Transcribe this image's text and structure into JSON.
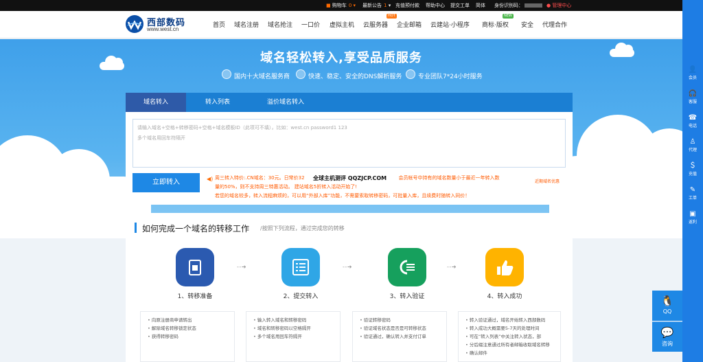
{
  "topbar": {
    "cart_label": "购物车",
    "cart_count": "0",
    "announcement": "最新公告",
    "announcement_count": "1",
    "prepay": "充值预付款",
    "help": "帮助中心",
    "ticket": "提交工单",
    "simplified": "简体",
    "id_label": "身份识别码：",
    "admin": "管理中心"
  },
  "header": {
    "logo_name": "西部数码",
    "logo_url": "www.west.cn",
    "nav": [
      "首页",
      "域名注册",
      "域名抢注",
      "一口价",
      "虚拟主机",
      "云服务器",
      "企业邮箱",
      "云建站·小程序",
      "商标·版权",
      "安全",
      "代理合作"
    ],
    "badge_hot": "HOT",
    "badge_new": "NEW"
  },
  "banner": {
    "headline": "域名轻松转入,享受品质服务",
    "features": [
      "国内十大域名服务商",
      "快速、稳定、安全的DNS解析服务",
      "专业团队7*24小时服务"
    ]
  },
  "card": {
    "tabs": [
      "域名转入",
      "转入列表",
      "溢价域名转入"
    ],
    "placeholder_line1": "请输入域名+空格+转移密码+空格+域名模板ID（此项可不填），比如：west.cn  password1  123",
    "placeholder_line2": "多个域名用回车符隔开",
    "submit": "立即转入",
    "notice_line1a": "周三转入特价:.CN域名：30元。日常价32",
    "notice_line1b": "会员帐号中持有的域名数量小于最近一年转入数",
    "notice_line2": "量的50%，则不支持周三特惠活动。  建站域名5折转入活动开始了!",
    "notice_line3": "若您的域名较多，转入流程麻烦的，可以用“外部入库”功能，不需要索取转移密码，可批量入库，且续费时随转入同价！",
    "overlay": "全球主机测评 QQZJCP.COM",
    "recent_link": "近期域名优惠"
  },
  "process": {
    "title": "如何完成一个域名的转移工作",
    "subtitle": "/按照下列流程，通过完成您的转移",
    "steps": [
      {
        "label": "1、转移准备",
        "items": [
          "向原注册商申请转出",
          "解除域名转移锁定状态",
          "获得转移密码"
        ]
      },
      {
        "label": "2、提交转入",
        "items": [
          "输入转入域名和转移密码",
          "域名和转移密码以空格隔开",
          "多个域名用回车符隔开"
        ]
      },
      {
        "label": "3、转入验证",
        "items": [
          "验证转移密码",
          "验证域名状态是否是可转移状态",
          "验证通过，确认转入并支付订单"
        ]
      },
      {
        "label": "4、转入成功",
        "items": [
          "转入验证通过，域名开始转入西部数码",
          "转入成功大概需要5-7天的处理时间",
          "可在“转入列表”中关注转入状态，部",
          "分后缀注意通过所有者邮箱收取域名转移",
          "确认邮件"
        ]
      }
    ],
    "colors": [
      "#2b5ab0",
      "#2fa6e6",
      "#16a05d",
      "#ffb300"
    ]
  },
  "sidebar": {
    "items": [
      "会员",
      "客服",
      "电话",
      "代理",
      "充值",
      "工单",
      "返利"
    ],
    "qq": "QQ",
    "consult": "咨询"
  }
}
